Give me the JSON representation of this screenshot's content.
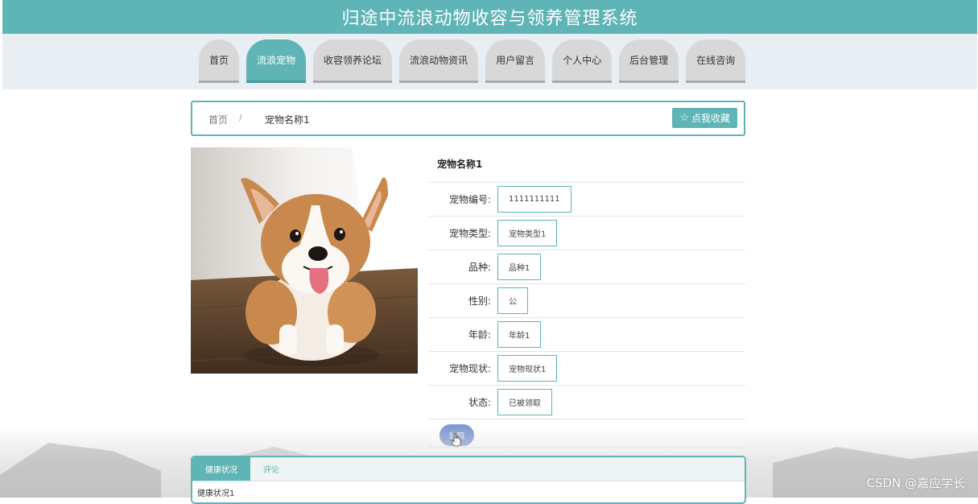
{
  "header": {
    "title": "归途中流浪动物收容与领养管理系统"
  },
  "nav": {
    "items": [
      {
        "label": "首页"
      },
      {
        "label": "流浪宠物"
      },
      {
        "label": "收容领养论坛"
      },
      {
        "label": "流浪动物资讯"
      },
      {
        "label": "用户留言"
      },
      {
        "label": "个人中心"
      },
      {
        "label": "后台管理"
      },
      {
        "label": "在线咨询"
      }
    ],
    "active_index": 1
  },
  "breadcrumb": {
    "home": "首页",
    "separator": "/",
    "current": "宠物名称1",
    "favorite_label": "点我收藏"
  },
  "pet": {
    "name": "宠物名称1",
    "fields": [
      {
        "label": "宠物编号:",
        "value": "1111111111"
      },
      {
        "label": "宠物类型:",
        "value": "宠物类型1"
      },
      {
        "label": "品种:",
        "value": "品种1"
      },
      {
        "label": "性别:",
        "value": "公"
      },
      {
        "label": "年龄:",
        "value": "年龄1"
      },
      {
        "label": "宠物现状:",
        "value": "宠物现状1"
      },
      {
        "label": "状态:",
        "value": "已被领取"
      }
    ],
    "adopt_label": "领取"
  },
  "tabs": {
    "items": [
      {
        "label": "健康状况"
      },
      {
        "label": "评论"
      }
    ],
    "content": "健康状况1"
  },
  "watermark": "CSDN @嘉应学长",
  "colors": {
    "accent": "#5fb4b6",
    "adopt_button": "#7f9ad2"
  }
}
